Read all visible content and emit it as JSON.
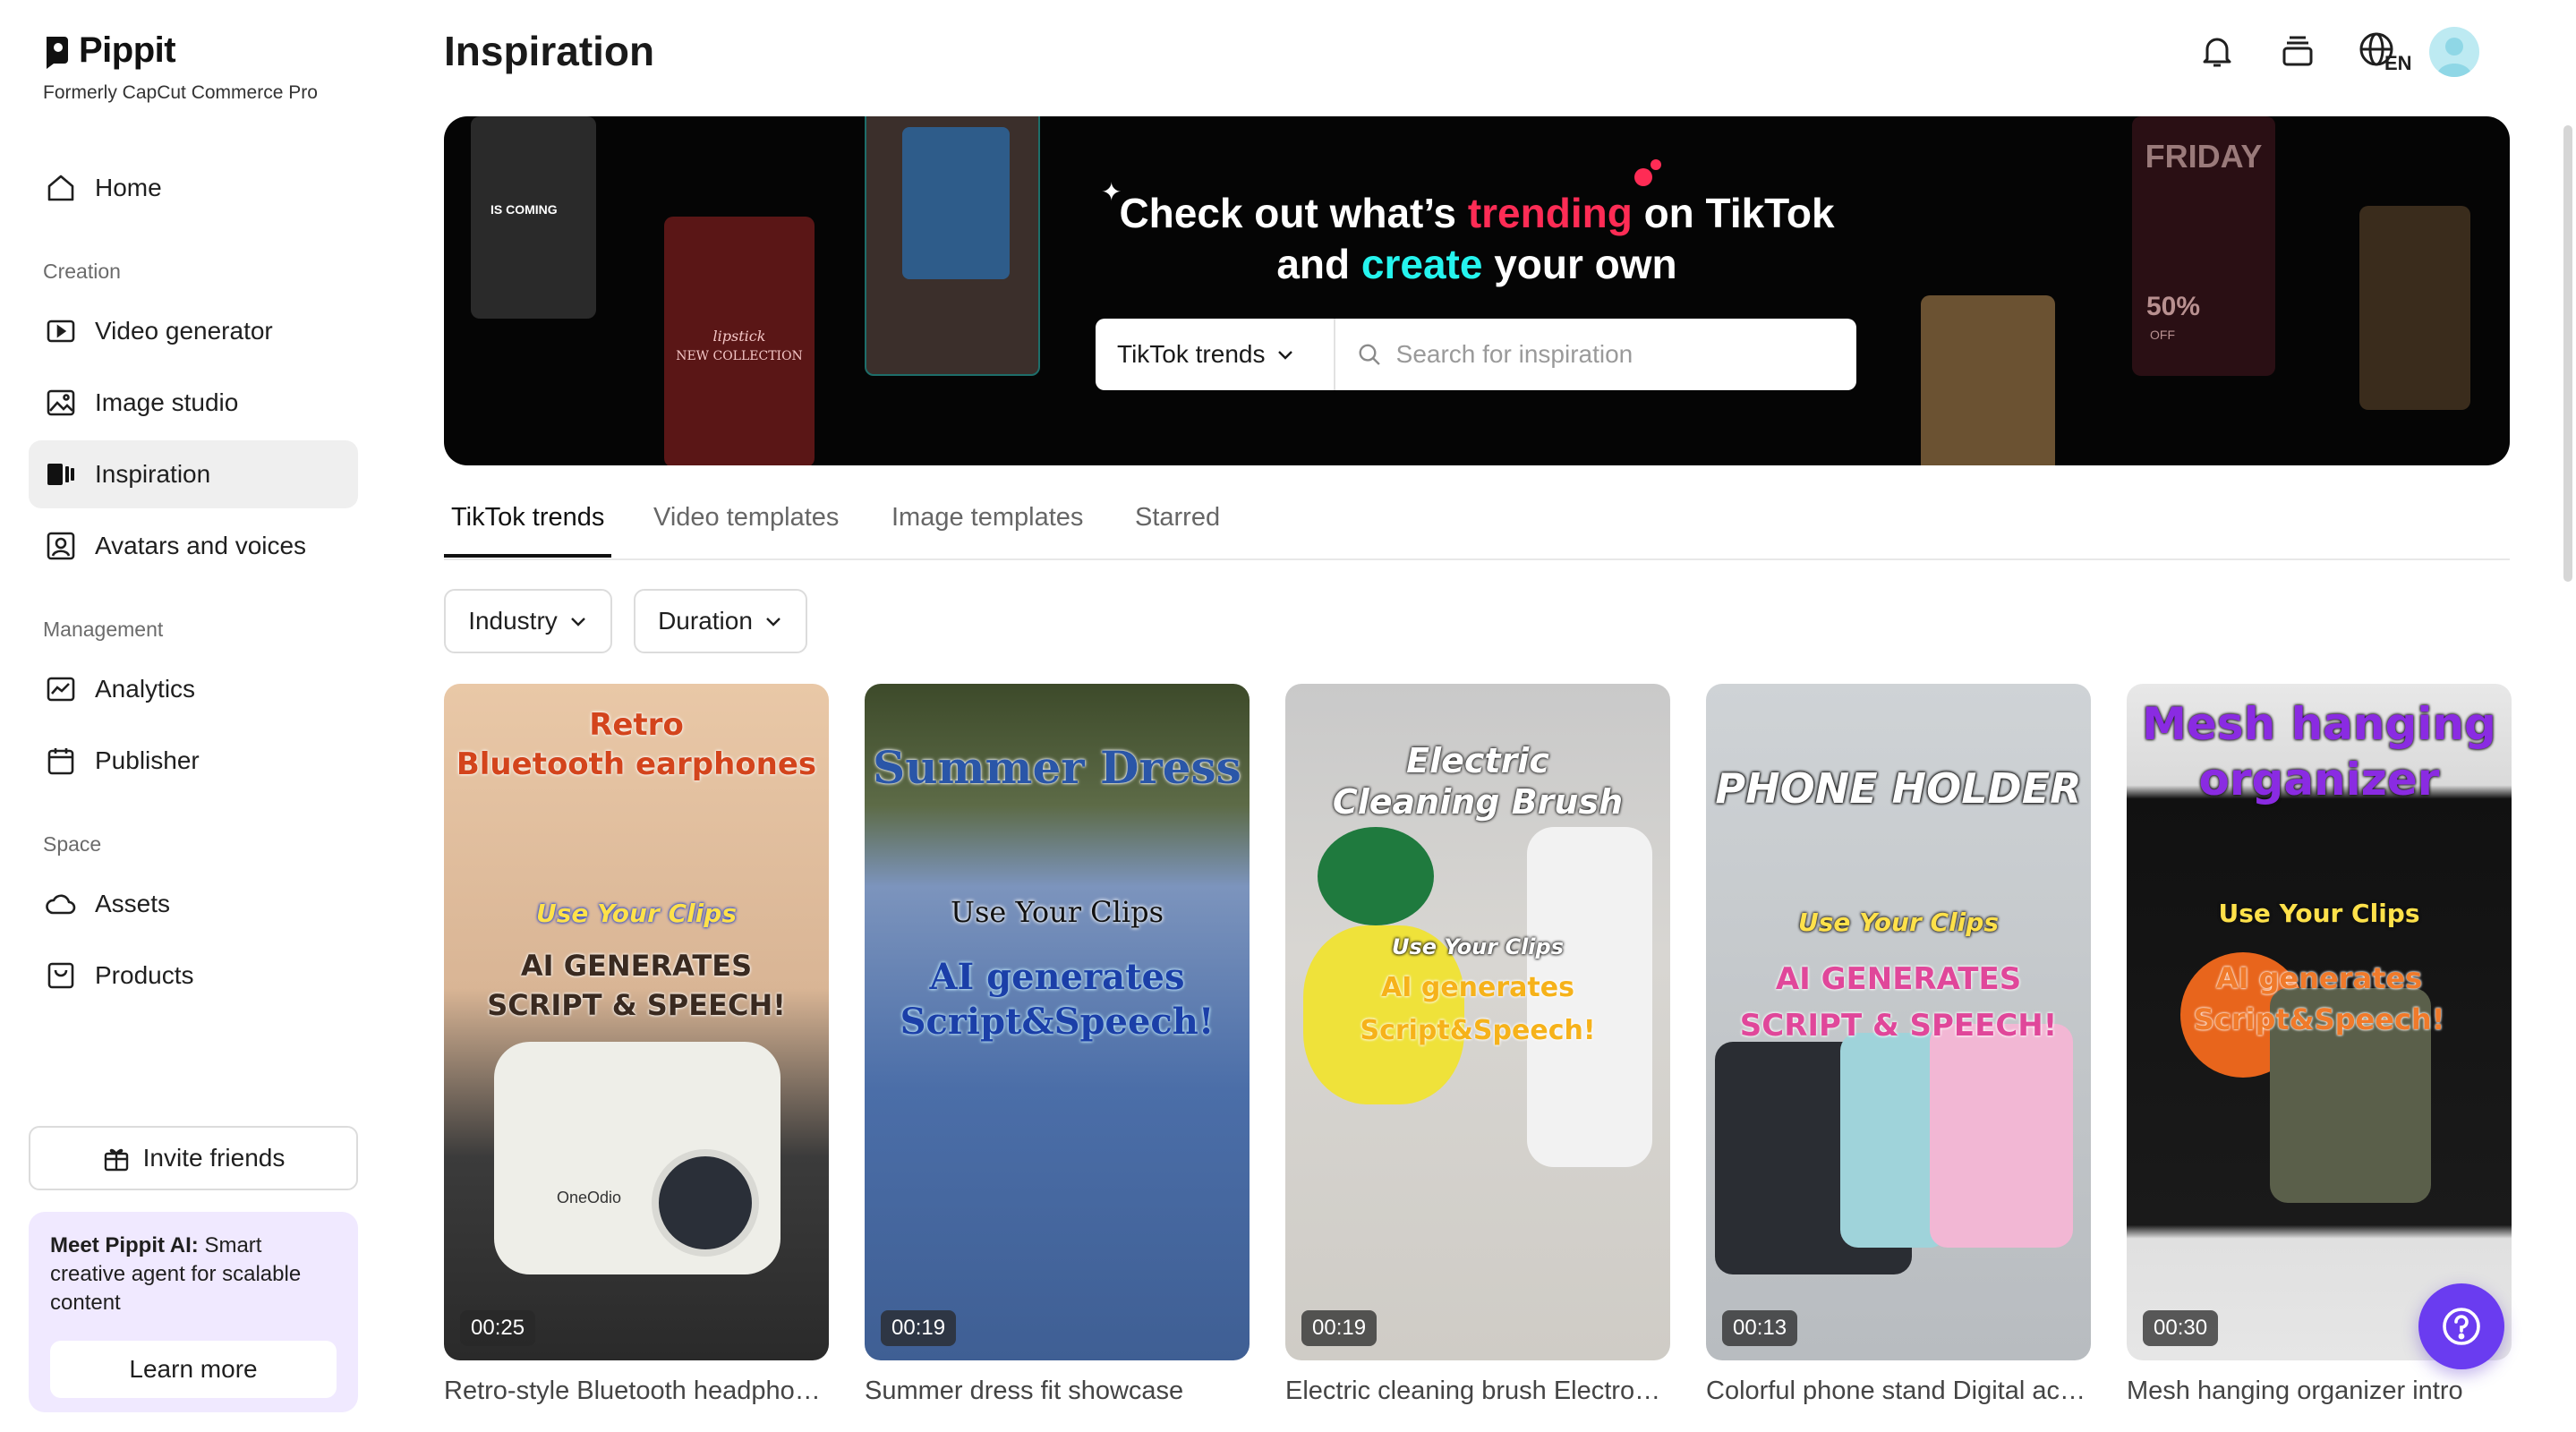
{
  "brand": {
    "name": "Pippit",
    "subtitle": "Formerly CapCut Commerce Pro"
  },
  "sidebar": {
    "home": "Home",
    "creation_label": "Creation",
    "creation": [
      "Video generator",
      "Image studio",
      "Inspiration",
      "Avatars and voices"
    ],
    "management_label": "Management",
    "management": [
      "Analytics",
      "Publisher"
    ],
    "space_label": "Space",
    "space": [
      "Assets",
      "Products"
    ],
    "active": "Inspiration",
    "invite": "Invite friends",
    "promo": {
      "bold": "Meet Pippit AI:",
      "text": " Smart creative agent for scalable content",
      "button": "Learn more"
    }
  },
  "header": {
    "title": "Inspiration",
    "icons": [
      "bell-icon",
      "stack-icon",
      "globe-language-icon",
      "avatar"
    ],
    "language": "EN"
  },
  "banner": {
    "line1_a": "Check out what’s ",
    "line1_highlight": "trending",
    "line1_b": " on TikTok",
    "line2_a": "and ",
    "line2_highlight": "create",
    "line2_b": " your own",
    "search_category": "TikTok trends",
    "search_placeholder": "Search for inspiration",
    "thumb_text": {
      "is_coming": "IS COMING",
      "lipstick": "lipstick",
      "new_collection": "NEW COLLECTION",
      "friday": "FRIDAY",
      "percent": "50%",
      "off": "OFF"
    }
  },
  "tabs": [
    "TikTok trends",
    "Video templates",
    "Image templates",
    "Starred"
  ],
  "active_tab": "TikTok trends",
  "filters": [
    "Industry",
    "Duration"
  ],
  "cards": [
    {
      "title": "Retro-style Bluetooth headphones",
      "duration": "00:25",
      "line1": "Retro",
      "line2": "Bluetooth earphones",
      "clips": "Use Your Clips",
      "ai1": "AI GENERATES",
      "ai2": "SCRIPT & SPEECH!",
      "brand_mark": "OneOdio"
    },
    {
      "title": "Summer dress fit showcase",
      "duration": "00:19",
      "line1": "Summer Dress",
      "line2": "",
      "clips": "Use Your Clips",
      "ai1": "AI generates",
      "ai2": "Script&Speech!"
    },
    {
      "title": "Electric cleaning brush Electronics",
      "duration": "00:19",
      "line1": "Electric",
      "line2": "Cleaning Brush",
      "clips": "Use Your Clips",
      "ai1": "AI generates",
      "ai2": "Script&Speech!"
    },
    {
      "title": "Colorful phone stand Digital accessories",
      "duration": "00:13",
      "line1": "PHONE HOLDER",
      "line2": "",
      "clips": "Use Your Clips",
      "ai1": "AI GENERATES",
      "ai2": "SCRIPT & SPEECH!"
    },
    {
      "title": "Mesh hanging organizer intro",
      "duration": "00:30",
      "line1": "Mesh hanging",
      "line2": "organizer",
      "clips": "Use Your Clips",
      "ai1": "AI generates",
      "ai2": "Script&Speech!"
    }
  ],
  "colors": {
    "accent": "#6a3cf0",
    "tiktok_pink": "#fe2c55",
    "tiktok_cyan": "#25f4ee",
    "promo_bg": "#f0e9ff"
  }
}
